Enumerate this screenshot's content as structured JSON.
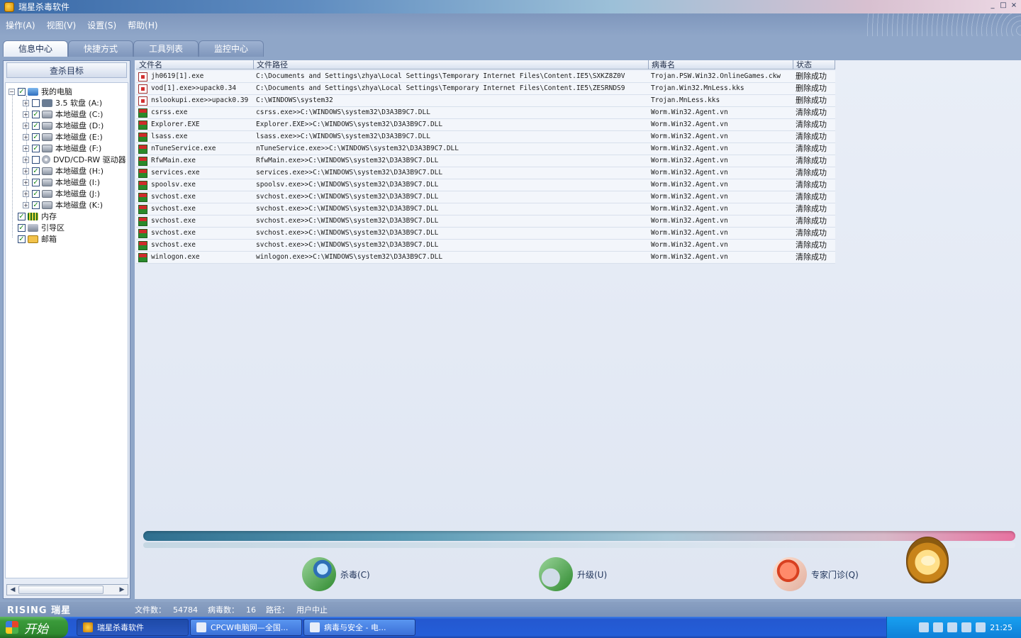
{
  "window": {
    "title": "瑞星杀毒软件",
    "buttons": [
      "_",
      "□",
      "×"
    ]
  },
  "menu": [
    {
      "label": "操作(A)"
    },
    {
      "label": "视图(V)"
    },
    {
      "label": "设置(S)"
    },
    {
      "label": "帮助(H)"
    }
  ],
  "tabs": [
    {
      "label": "信息中心",
      "active": true
    },
    {
      "label": "快捷方式",
      "active": false
    },
    {
      "label": "工具列表",
      "active": false
    },
    {
      "label": "监控中心",
      "active": false
    }
  ],
  "left_panel": {
    "title": "查杀目标",
    "tree": [
      {
        "label": "我的电脑",
        "level": 0,
        "expander": "−",
        "checked": true,
        "icon": "computer"
      },
      {
        "label": "3.5 软盘 (A:)",
        "level": 1,
        "expander": "+",
        "checked": false,
        "icon": "floppy"
      },
      {
        "label": "本地磁盘 (C:)",
        "level": 1,
        "expander": "+",
        "checked": true,
        "icon": "disk"
      },
      {
        "label": "本地磁盘 (D:)",
        "level": 1,
        "expander": "+",
        "checked": true,
        "icon": "disk"
      },
      {
        "label": "本地磁盘 (E:)",
        "level": 1,
        "expander": "+",
        "checked": true,
        "icon": "disk"
      },
      {
        "label": "本地磁盘 (F:)",
        "level": 1,
        "expander": "+",
        "checked": true,
        "icon": "disk"
      },
      {
        "label": "DVD/CD-RW 驱动器",
        "level": 1,
        "expander": "+",
        "checked": false,
        "icon": "dvd"
      },
      {
        "label": "本地磁盘 (H:)",
        "level": 1,
        "expander": "+",
        "checked": true,
        "icon": "disk"
      },
      {
        "label": "本地磁盘 (I:)",
        "level": 1,
        "expander": "+",
        "checked": true,
        "icon": "disk"
      },
      {
        "label": "本地磁盘 (J:)",
        "level": 1,
        "expander": "+",
        "checked": true,
        "icon": "disk"
      },
      {
        "label": "本地磁盘 (K:)",
        "level": 1,
        "expander": "+",
        "checked": true,
        "icon": "disk"
      },
      {
        "label": "内存",
        "level": 0,
        "expander": "",
        "checked": true,
        "icon": "mem"
      },
      {
        "label": "引导区",
        "level": 0,
        "expander": "",
        "checked": true,
        "icon": "boot"
      },
      {
        "label": "邮箱",
        "level": 0,
        "expander": "",
        "checked": true,
        "icon": "mail"
      }
    ]
  },
  "table": {
    "columns": [
      "文件名",
      "文件路径",
      "病毒名",
      "状态"
    ],
    "rows": [
      {
        "kind": "trojan",
        "file": "jh0619[1].exe",
        "path": "C:\\Documents and Settings\\zhya\\Local Settings\\Temporary Internet Files\\Content.IE5\\SXKZ8Z0V",
        "virus": "Trojan.PSW.Win32.OnlineGames.ckw",
        "status": "删除成功"
      },
      {
        "kind": "trojan",
        "file": "vod[1].exe>>upack0.34",
        "path": "C:\\Documents and Settings\\zhya\\Local Settings\\Temporary Internet Files\\Content.IE5\\ZESRNDS9",
        "virus": "Trojan.Win32.MnLess.kks",
        "status": "删除成功"
      },
      {
        "kind": "trojan",
        "file": "nslookupi.exe>>upack0.39",
        "path": "C:\\WINDOWS\\system32",
        "virus": "Trojan.MnLess.kks",
        "status": "删除成功"
      },
      {
        "kind": "worm",
        "file": "csrss.exe",
        "path": "csrss.exe>>C:\\WINDOWS\\system32\\D3A3B9C7.DLL",
        "virus": "Worm.Win32.Agent.vn",
        "status": "清除成功"
      },
      {
        "kind": "worm",
        "file": "Explorer.EXE",
        "path": "Explorer.EXE>>C:\\WINDOWS\\system32\\D3A3B9C7.DLL",
        "virus": "Worm.Win32.Agent.vn",
        "status": "清除成功"
      },
      {
        "kind": "worm",
        "file": "lsass.exe",
        "path": "lsass.exe>>C:\\WINDOWS\\system32\\D3A3B9C7.DLL",
        "virus": "Worm.Win32.Agent.vn",
        "status": "清除成功"
      },
      {
        "kind": "worm",
        "file": "nTuneService.exe",
        "path": "nTuneService.exe>>C:\\WINDOWS\\system32\\D3A3B9C7.DLL",
        "virus": "Worm.Win32.Agent.vn",
        "status": "清除成功"
      },
      {
        "kind": "worm",
        "file": "RfwMain.exe",
        "path": "RfwMain.exe>>C:\\WINDOWS\\system32\\D3A3B9C7.DLL",
        "virus": "Worm.Win32.Agent.vn",
        "status": "清除成功"
      },
      {
        "kind": "worm",
        "file": "services.exe",
        "path": "services.exe>>C:\\WINDOWS\\system32\\D3A3B9C7.DLL",
        "virus": "Worm.Win32.Agent.vn",
        "status": "清除成功"
      },
      {
        "kind": "worm",
        "file": "spoolsv.exe",
        "path": "spoolsv.exe>>C:\\WINDOWS\\system32\\D3A3B9C7.DLL",
        "virus": "Worm.Win32.Agent.vn",
        "status": "清除成功"
      },
      {
        "kind": "worm",
        "file": "svchost.exe",
        "path": "svchost.exe>>C:\\WINDOWS\\system32\\D3A3B9C7.DLL",
        "virus": "Worm.Win32.Agent.vn",
        "status": "清除成功"
      },
      {
        "kind": "worm",
        "file": "svchost.exe",
        "path": "svchost.exe>>C:\\WINDOWS\\system32\\D3A3B9C7.DLL",
        "virus": "Worm.Win32.Agent.vn",
        "status": "清除成功"
      },
      {
        "kind": "worm",
        "file": "svchost.exe",
        "path": "svchost.exe>>C:\\WINDOWS\\system32\\D3A3B9C7.DLL",
        "virus": "Worm.Win32.Agent.vn",
        "status": "清除成功"
      },
      {
        "kind": "worm",
        "file": "svchost.exe",
        "path": "svchost.exe>>C:\\WINDOWS\\system32\\D3A3B9C7.DLL",
        "virus": "Worm.Win32.Agent.vn",
        "status": "清除成功"
      },
      {
        "kind": "worm",
        "file": "svchost.exe",
        "path": "svchost.exe>>C:\\WINDOWS\\system32\\D3A3B9C7.DLL",
        "virus": "Worm.Win32.Agent.vn",
        "status": "清除成功"
      },
      {
        "kind": "worm",
        "file": "winlogon.exe",
        "path": "winlogon.exe>>C:\\WINDOWS\\system32\\D3A3B9C7.DLL",
        "virus": "Worm.Win32.Agent.vn",
        "status": "清除成功"
      }
    ]
  },
  "actions": {
    "scan_label": "杀毒(C)",
    "upgrade_label": "升级(U)",
    "expert_label": "专家门诊(Q)"
  },
  "status": {
    "brand": "RISING 瑞星",
    "files_label": "文件数：",
    "files_value": "54784",
    "virus_label": "病毒数：",
    "virus_value": "16",
    "path_label": "路径：",
    "path_value": "用户中止"
  },
  "taskbar": {
    "start_label": "开始",
    "tasks": [
      {
        "label": "瑞星杀毒软件",
        "active": true
      },
      {
        "label": "CPCW电脑网—全国...",
        "active": false
      },
      {
        "label": "病毒与安全 - 电...",
        "active": false
      }
    ],
    "clock": "21:25"
  },
  "colors": {
    "accent": "#8fa6c8",
    "taskbar": "#245ed8",
    "start": "#3a9a3a"
  },
  "icons": {
    "trojan": "trojan-file-icon",
    "worm": "worm-file-icon"
  }
}
